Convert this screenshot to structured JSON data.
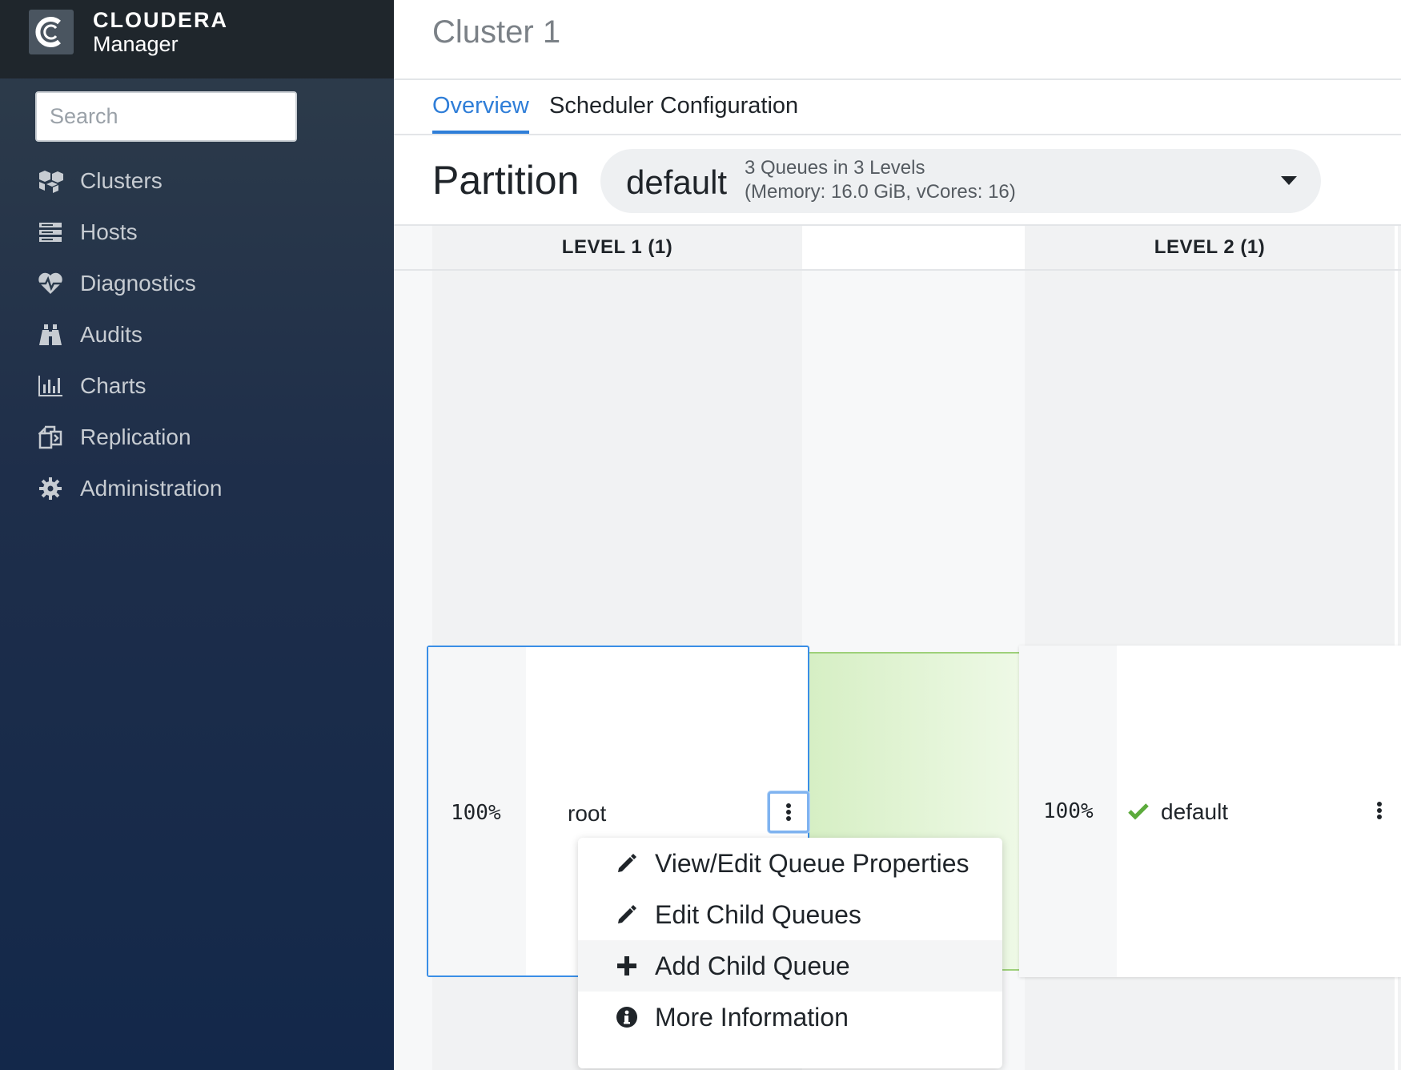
{
  "brand": {
    "name": "CLOUDERA",
    "product": "Manager"
  },
  "search": {
    "placeholder": "Search"
  },
  "sidebar": {
    "items": [
      {
        "label": "Clusters",
        "icon": "cubes-icon"
      },
      {
        "label": "Hosts",
        "icon": "server-icon"
      },
      {
        "label": "Diagnostics",
        "icon": "heartbeat-icon"
      },
      {
        "label": "Audits",
        "icon": "binoculars-icon"
      },
      {
        "label": "Charts",
        "icon": "bar-chart-icon"
      },
      {
        "label": "Replication",
        "icon": "copy-icon"
      },
      {
        "label": "Administration",
        "icon": "gear-icon"
      }
    ]
  },
  "header": {
    "title": "Cluster 1"
  },
  "tabs": [
    {
      "label": "Overview",
      "active": true
    },
    {
      "label": "Scheduler Configuration",
      "active": false
    }
  ],
  "partition": {
    "label": "Partition",
    "selected": "default",
    "info_line1": "3 Queues in 3 Levels",
    "info_line2": "(Memory: 16.0 GiB, vCores: 16)"
  },
  "levels": [
    {
      "header": "LEVEL 1 (1)"
    },
    {
      "header": "LEVEL 2 (1)"
    }
  ],
  "queues": {
    "root": {
      "percent": "100%",
      "name": "root"
    },
    "default": {
      "percent": "100%",
      "name": "default",
      "status": "active"
    }
  },
  "menu": {
    "items": [
      {
        "label": "View/Edit Queue Properties",
        "icon": "pencil-icon"
      },
      {
        "label": "Edit Child Queues",
        "icon": "pencil-icon"
      },
      {
        "label": "Add Child Queue",
        "icon": "plus-icon"
      },
      {
        "label": "More Information",
        "icon": "info-circle-icon"
      }
    ]
  },
  "colors": {
    "accent": "#2f7ed8",
    "sidebar_top": "#2f3d4a",
    "sidebar_bottom": "#13284a",
    "success": "#5cab3c"
  }
}
